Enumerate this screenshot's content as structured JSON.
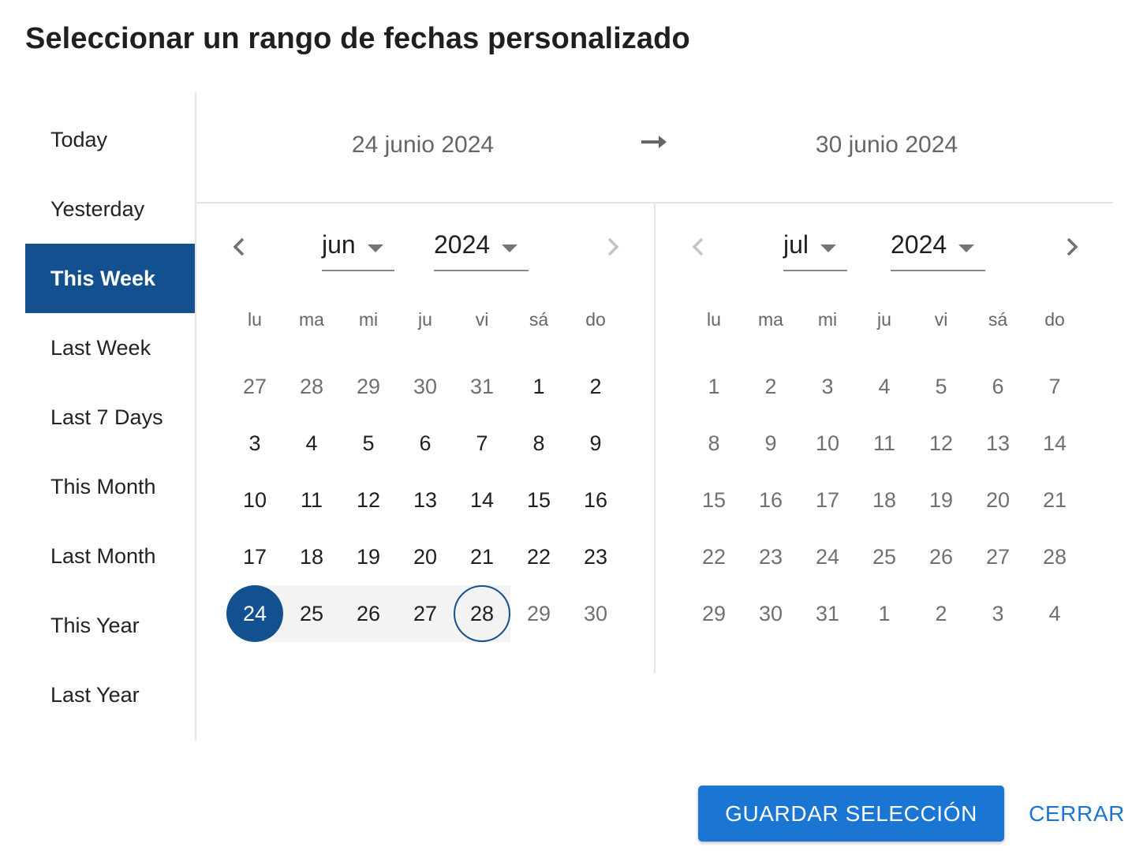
{
  "dialog": {
    "title": "Seleccionar un rango de fechas personalizado"
  },
  "sidebar": {
    "items": [
      {
        "label": "Today",
        "active": false
      },
      {
        "label": "Yesterday",
        "active": false
      },
      {
        "label": "This Week",
        "active": true
      },
      {
        "label": "Last Week",
        "active": false
      },
      {
        "label": "Last 7 Days",
        "active": false
      },
      {
        "label": "This Month",
        "active": false
      },
      {
        "label": "Last Month",
        "active": false
      },
      {
        "label": "This Year",
        "active": false
      },
      {
        "label": "Last Year",
        "active": false
      }
    ]
  },
  "range": {
    "start_label": "24 junio 2024",
    "end_label": "30 junio 2024",
    "arrow_icon": "arrow-right-icon"
  },
  "colors": {
    "primary": "#12508f",
    "button": "#1b76d3",
    "range_bg": "#f3f3f3"
  },
  "calendars": [
    {
      "month": "jun",
      "year": "2024",
      "prev_enabled": true,
      "next_enabled": false,
      "weekdays": [
        "lu",
        "ma",
        "mi",
        "ju",
        "vi",
        "sá",
        "do"
      ],
      "weeks": [
        [
          {
            "d": "27",
            "muted": true
          },
          {
            "d": "28",
            "muted": true
          },
          {
            "d": "29",
            "muted": true
          },
          {
            "d": "30",
            "muted": true
          },
          {
            "d": "31",
            "muted": true
          },
          {
            "d": "1"
          },
          {
            "d": "2"
          }
        ],
        [
          {
            "d": "3"
          },
          {
            "d": "4"
          },
          {
            "d": "5"
          },
          {
            "d": "6"
          },
          {
            "d": "7"
          },
          {
            "d": "8"
          },
          {
            "d": "9"
          }
        ],
        [
          {
            "d": "10"
          },
          {
            "d": "11"
          },
          {
            "d": "12"
          },
          {
            "d": "13"
          },
          {
            "d": "14"
          },
          {
            "d": "15"
          },
          {
            "d": "16"
          }
        ],
        [
          {
            "d": "17"
          },
          {
            "d": "18"
          },
          {
            "d": "19"
          },
          {
            "d": "20"
          },
          {
            "d": "21"
          },
          {
            "d": "22"
          },
          {
            "d": "23"
          }
        ],
        [
          {
            "d": "24",
            "state": "start"
          },
          {
            "d": "25",
            "state": "in-range"
          },
          {
            "d": "26",
            "state": "in-range"
          },
          {
            "d": "27",
            "state": "in-range"
          },
          {
            "d": "28",
            "state": "hover-end"
          },
          {
            "d": "29",
            "muted": true
          },
          {
            "d": "30",
            "muted": true
          }
        ]
      ]
    },
    {
      "month": "jul",
      "year": "2024",
      "prev_enabled": false,
      "next_enabled": true,
      "weekdays": [
        "lu",
        "ma",
        "mi",
        "ju",
        "vi",
        "sá",
        "do"
      ],
      "weeks": [
        [
          {
            "d": "1",
            "muted": true
          },
          {
            "d": "2",
            "muted": true
          },
          {
            "d": "3",
            "muted": true
          },
          {
            "d": "4",
            "muted": true
          },
          {
            "d": "5",
            "muted": true
          },
          {
            "d": "6",
            "muted": true
          },
          {
            "d": "7",
            "muted": true
          }
        ],
        [
          {
            "d": "8",
            "muted": true
          },
          {
            "d": "9",
            "muted": true
          },
          {
            "d": "10",
            "muted": true
          },
          {
            "d": "11",
            "muted": true
          },
          {
            "d": "12",
            "muted": true
          },
          {
            "d": "13",
            "muted": true
          },
          {
            "d": "14",
            "muted": true
          }
        ],
        [
          {
            "d": "15",
            "muted": true
          },
          {
            "d": "16",
            "muted": true
          },
          {
            "d": "17",
            "muted": true
          },
          {
            "d": "18",
            "muted": true
          },
          {
            "d": "19",
            "muted": true
          },
          {
            "d": "20",
            "muted": true
          },
          {
            "d": "21",
            "muted": true
          }
        ],
        [
          {
            "d": "22",
            "muted": true
          },
          {
            "d": "23",
            "muted": true
          },
          {
            "d": "24",
            "muted": true
          },
          {
            "d": "25",
            "muted": true
          },
          {
            "d": "26",
            "muted": true
          },
          {
            "d": "27",
            "muted": true
          },
          {
            "d": "28",
            "muted": true
          }
        ],
        [
          {
            "d": "29",
            "muted": true
          },
          {
            "d": "30",
            "muted": true
          },
          {
            "d": "31",
            "muted": true
          },
          {
            "d": "1",
            "muted": true
          },
          {
            "d": "2",
            "muted": true
          },
          {
            "d": "3",
            "muted": true
          },
          {
            "d": "4",
            "muted": true
          }
        ]
      ]
    }
  ],
  "footer": {
    "save_label": "GUARDAR SELECCIÓN",
    "close_label": "CERRAR"
  }
}
